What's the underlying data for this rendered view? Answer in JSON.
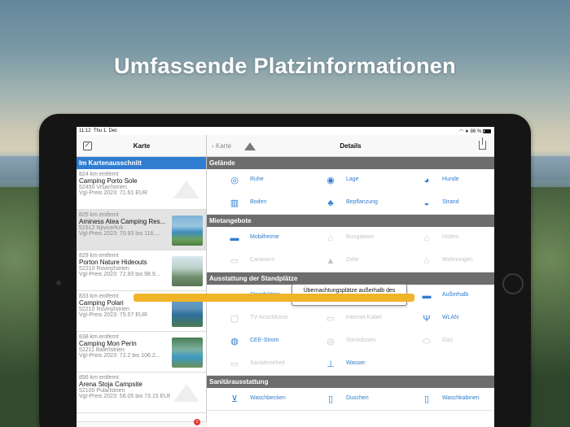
{
  "headline": "Umfassende Platzinformationen",
  "status": {
    "time": "11:12",
    "date": "Thu 1. Dec",
    "battery": "86 %"
  },
  "left": {
    "title": "Karte",
    "section": "Im Kartenausschnitt",
    "rows": [
      {
        "dist": "824 km entfernt",
        "name": "Camping Porto Sole",
        "loc": "52450 Vrsar/Istrien",
        "price": "Vgl-Preis 2023: 71.61 EUR"
      },
      {
        "dist": "825 km entfernt",
        "name": "Aminess Atea Camping Res...",
        "loc": "51512 Njivice/Krk",
        "price": "Vgl-Preis 2023: 70.93 bis 116...."
      },
      {
        "dist": "829 km entfernt",
        "name": "Porton Nature Hideouts",
        "loc": "52210 Rovinj/Istrien",
        "price": "Vgl-Preis 2023: 72.93 bis 98.9..."
      },
      {
        "dist": "833 km entfernt",
        "name": "Camping Polari",
        "loc": "52210 Rovinj/Istrien",
        "price": "Vgl-Preis 2023: 75.57 EUR"
      },
      {
        "dist": "838 km entfernt",
        "name": "Camping Mon Perin",
        "loc": "52211 Bale/Istrien",
        "price": "Vgl-Preis 2023: 72.2 bis 106.2..."
      },
      {
        "dist": "856 km entfernt",
        "name": "Arena Stoja Campsite",
        "loc": "52100 Pula/Istrien",
        "price": "Vgl-Preis 2023: 58.05 bis 73.15 EUR"
      }
    ],
    "tab_badge": "1"
  },
  "right": {
    "back_label": "Karte",
    "title": "Details",
    "sections": [
      {
        "title": "Gelände",
        "items": [
          {
            "label": "Ruhe",
            "icon": "◎",
            "on": true
          },
          {
            "label": "Lage",
            "icon": "◉",
            "on": true
          },
          {
            "label": "Hunde",
            "icon": "◕",
            "on": true
          },
          {
            "label": "Boden",
            "icon": "▥",
            "on": true
          },
          {
            "label": "Bepflanzung",
            "icon": "♣",
            "on": true
          },
          {
            "label": "Strand",
            "icon": "◒",
            "on": true
          }
        ]
      },
      {
        "title": "Mietangebote",
        "items": [
          {
            "label": "Mobilheime",
            "icon": "▬",
            "on": true
          },
          {
            "label": "Bungalows",
            "icon": "⌂",
            "on": false
          },
          {
            "label": "Hütten",
            "icon": "⌂",
            "on": false
          },
          {
            "label": "Caravans",
            "icon": "▭",
            "on": false
          },
          {
            "label": "Zelte",
            "icon": "▲",
            "on": false
          },
          {
            "label": "Wohnungen",
            "icon": "⌂",
            "on": false
          }
        ]
      },
      {
        "title": "Ausstattung der Standplätze",
        "items": [
          {
            "label": "Standplätze",
            "icon": "▱",
            "on": true
          },
          {
            "label": "",
            "icon": "",
            "on": true
          },
          {
            "label": "Außerhalb",
            "icon": "▬",
            "on": true
          },
          {
            "label": "TV-Anschlüsse",
            "icon": "▢",
            "on": false
          },
          {
            "label": "Internet Kabel",
            "icon": "▭",
            "on": false
          },
          {
            "label": "WLAN",
            "icon": "Ψ",
            "on": true
          },
          {
            "label": "CEE-Strom",
            "icon": "◍",
            "on": true
          },
          {
            "label": "Steckdosen",
            "icon": "◎",
            "on": false
          },
          {
            "label": "Gas",
            "icon": "⬭",
            "on": false
          },
          {
            "label": "Sanitäreinheit",
            "icon": "▭",
            "on": false
          },
          {
            "label": "Wasser",
            "icon": "⊥",
            "on": true
          },
          {
            "label": "",
            "icon": "",
            "on": false
          }
        ]
      },
      {
        "title": "Sanitärausstattung",
        "items": [
          {
            "label": "Waschbecken",
            "icon": "⊻",
            "on": true
          },
          {
            "label": "Duschen",
            "icon": "▯",
            "on": true
          },
          {
            "label": "Waschkabinen",
            "icon": "▯",
            "on": true
          }
        ]
      }
    ],
    "tooltip": "Übernachtungsplätze außerhalb des Platzgeländes vorhanden"
  },
  "colors": {
    "accent": "#2f7dd0",
    "section_header": "#6d6d6d",
    "banner": "#f0b429"
  }
}
